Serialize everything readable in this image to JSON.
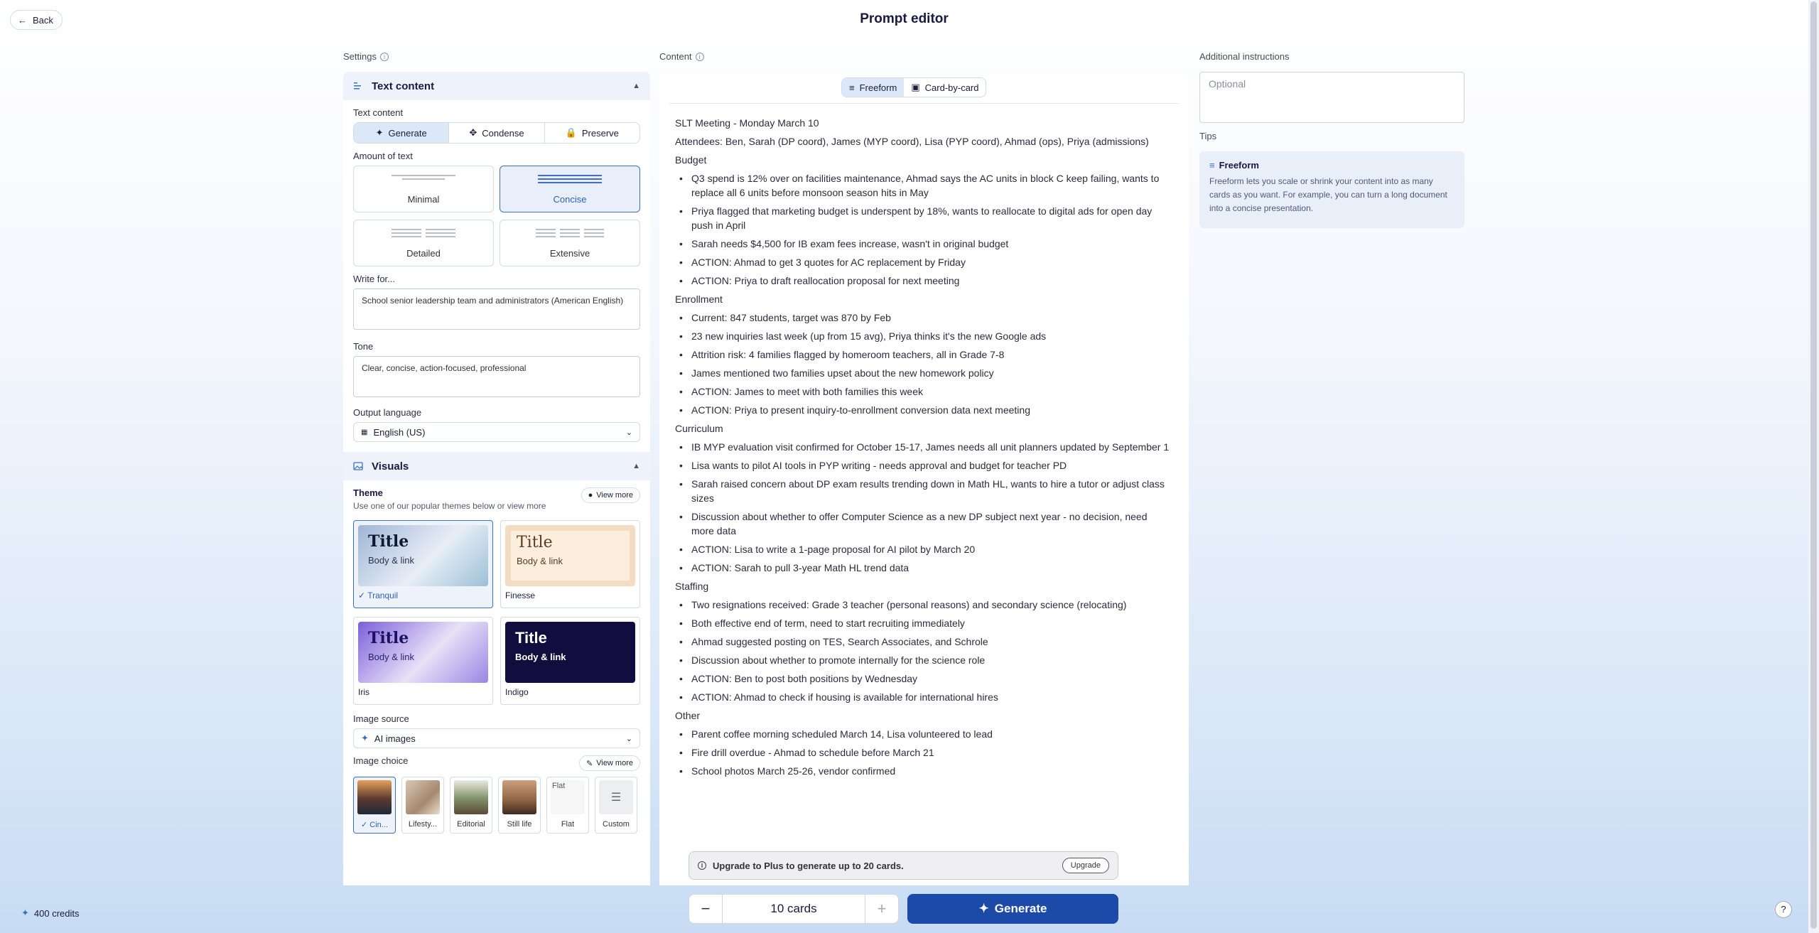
{
  "header": {
    "back_label": "Back",
    "title": "Prompt editor"
  },
  "labels": {
    "settings": "Settings",
    "content": "Content",
    "additional": "Additional instructions",
    "tips": "Tips"
  },
  "text_section": {
    "title": "Text content",
    "text_content_label": "Text content",
    "modes": [
      "Generate",
      "Condense",
      "Preserve"
    ],
    "amount_label": "Amount of text",
    "amounts": [
      "Minimal",
      "Concise",
      "Detailed",
      "Extensive"
    ],
    "write_for_label": "Write for...",
    "write_for_value": "School senior leadership team and administrators (American English)",
    "tone_label": "Tone",
    "tone_value": "Clear, concise, action-focused, professional",
    "language_label": "Output language",
    "language_value": "English (US)"
  },
  "visuals": {
    "title": "Visuals",
    "theme_label": "Theme",
    "theme_sub": "Use one of our popular themes below or view more",
    "view_more": "View more",
    "theme_title_text": "Title",
    "theme_body_text": "Body & link",
    "themes": [
      "Tranquil",
      "Finesse",
      "Iris",
      "Indigo"
    ],
    "image_source_label": "Image source",
    "image_source_value": "AI images",
    "image_choice_label": "Image choice",
    "image_choices": [
      "Cin...",
      "Lifesty...",
      "Editorial",
      "Still life",
      "Flat",
      "Custom"
    ],
    "flat_alt": "Flat"
  },
  "content": {
    "toggle": [
      "Freeform",
      "Card-by-card"
    ],
    "blocks": [
      {
        "kind": "para",
        "text": "SLT Meeting - Monday March 10"
      },
      {
        "kind": "para",
        "text": "Attendees: Ben, Sarah (DP coord), James (MYP coord), Lisa (PYP coord), Ahmad (ops), Priya (admissions)"
      },
      {
        "kind": "para",
        "text": "Budget"
      },
      {
        "kind": "list",
        "items": [
          "Q3 spend is 12% over on facilities maintenance, Ahmad says the AC units in block C keep failing, wants to replace all 6 units before monsoon season hits in May",
          "Priya flagged that marketing budget is underspent by 18%, wants to reallocate to digital ads for open day push in April",
          "Sarah needs $4,500 for IB exam fees increase, wasn't in original budget",
          "ACTION: Ahmad to get 3 quotes for AC replacement by Friday",
          "ACTION: Priya to draft reallocation proposal for next meeting"
        ]
      },
      {
        "kind": "para",
        "text": "Enrollment"
      },
      {
        "kind": "list",
        "items": [
          "Current: 847 students, target was 870 by Feb",
          "23 new inquiries last week (up from 15 avg), Priya thinks it's the new Google ads",
          "Attrition risk: 4 families flagged by homeroom teachers, all in Grade 7-8",
          "James mentioned two families upset about the new homework policy",
          "ACTION: James to meet with both families this week",
          "ACTION: Priya to present inquiry-to-enrollment conversion data next meeting"
        ]
      },
      {
        "kind": "para",
        "text": "Curriculum"
      },
      {
        "kind": "list",
        "items": [
          "IB MYP evaluation visit confirmed for October 15-17, James needs all unit planners updated by September 1",
          "Lisa wants to pilot AI tools in PYP writing - needs approval and budget for teacher PD",
          "Sarah raised concern about DP exam results trending down in Math HL, wants to hire a tutor or adjust class sizes",
          "Discussion about whether to offer Computer Science as a new DP subject next year - no decision, need more data",
          "ACTION: Lisa to write a 1-page proposal for AI pilot by March 20",
          "ACTION: Sarah to pull 3-year Math HL trend data"
        ]
      },
      {
        "kind": "para",
        "text": "Staffing"
      },
      {
        "kind": "list",
        "items": [
          "Two resignations received: Grade 3 teacher (personal reasons) and secondary science (relocating)",
          "Both effective end of term, need to start recruiting immediately",
          "Ahmad suggested posting on TES, Search Associates, and Schrole",
          "Discussion about whether to promote internally for the science role",
          "ACTION: Ben to post both positions by Wednesday",
          "ACTION: Ahmad to check if housing is available for international hires"
        ]
      },
      {
        "kind": "para",
        "text": "Other"
      },
      {
        "kind": "list",
        "items": [
          "Parent coffee morning scheduled March 14, Lisa volunteered to lead",
          "Fire drill overdue - Ahmad to schedule before March 21",
          "School photos March 25-26, vendor confirmed"
        ]
      }
    ]
  },
  "upsell": {
    "text": "Upgrade to Plus to generate up to 20 cards.",
    "button": "Upgrade"
  },
  "additional": {
    "placeholder": "Optional"
  },
  "tips": {
    "title": "Freeform",
    "body": "Freeform lets you scale or shrink your content into as many cards as you want. For example, you can turn a long document into a concise presentation."
  },
  "footer": {
    "credits": "400 credits",
    "cards": "10 cards",
    "generate": "Generate",
    "minus": "−",
    "plus": "+",
    "help": "?"
  },
  "colors": {
    "accent": "#1c4aa8",
    "selected_border": "#3e6fc4",
    "selected_bg": "#e8effb"
  }
}
